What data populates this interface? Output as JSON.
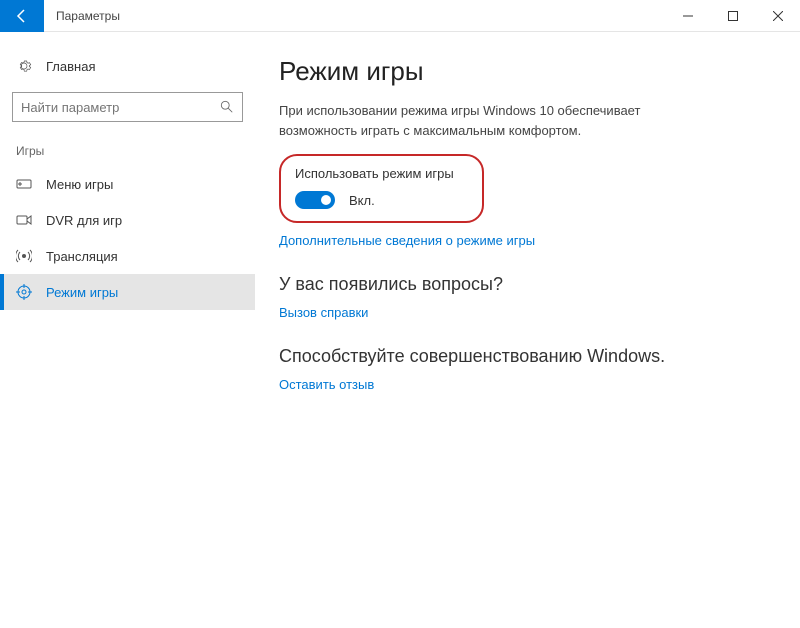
{
  "titlebar": {
    "title": "Параметры"
  },
  "sidebar": {
    "home": "Главная",
    "search_placeholder": "Найти параметр",
    "section": "Игры",
    "items": [
      {
        "label": "Меню игры"
      },
      {
        "label": "DVR для игр"
      },
      {
        "label": "Трансляция"
      },
      {
        "label": "Режим игры"
      }
    ]
  },
  "content": {
    "title": "Режим игры",
    "description": "При использовании режима игры Windows 10 обеспечивает возможность играть с максимальным комфортом.",
    "toggle_label": "Использовать режим игры",
    "toggle_state": "Вкл.",
    "learn_more": "Дополнительные сведения о режиме игры",
    "questions_heading": "У вас появились вопросы?",
    "help_link": "Вызов справки",
    "improve_heading": "Способствуйте совершенствованию Windows.",
    "feedback_link": "Оставить отзыв"
  }
}
